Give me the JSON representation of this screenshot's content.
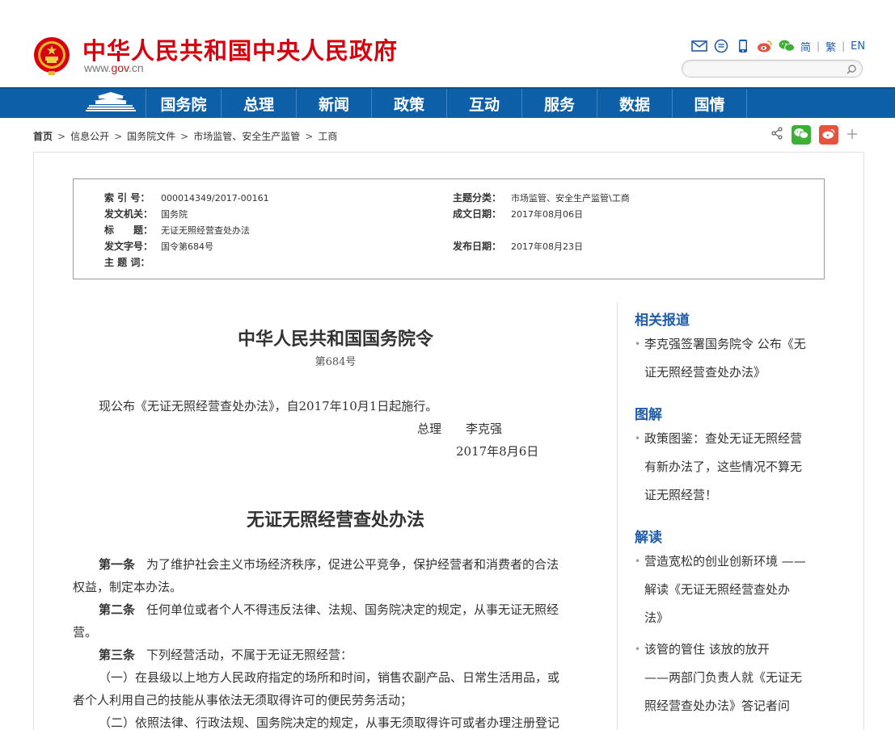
{
  "header": {
    "title": "中华人民共和国中央人民政府",
    "url_prefix": "www.",
    "url_gov": "gov",
    "url_suffix": ".cn",
    "lang_simplified": "简",
    "lang_traditional": "繁",
    "lang_english": "EN",
    "sep": "|",
    "icons": [
      "mail-icon",
      "message-icon",
      "mobile-icon",
      "weibo-icon",
      "wechat-icon"
    ]
  },
  "nav": {
    "items": [
      "国务院",
      "总理",
      "新闻",
      "政策",
      "互动",
      "服务",
      "数据",
      "国情"
    ]
  },
  "breadcrumb": {
    "items": [
      "首页",
      "信息公开",
      "国务院文件",
      "市场监管、安全生产监管",
      "工商"
    ],
    "separator": ">"
  },
  "info": {
    "index_label": "索 引 号：",
    "index_value": "000014349/2017-00161",
    "category_label": "主题分类：",
    "category_value": "市场监管、安全生产监管\\工商",
    "issuer_label": "发文机关：",
    "issuer_value": "国务院",
    "created_label": "成文日期：",
    "created_value": "2017年08月06日",
    "title_label": "标　　题：",
    "title_value": "无证无照经营查处办法",
    "docno_label": "发文字号：",
    "docno_value": "国令第684号",
    "published_label": "发布日期：",
    "published_value": "2017年08月23日",
    "keywords_label": "主 题 词："
  },
  "article": {
    "decree_title": "中华人民共和国国务院令",
    "decree_number": "第684号",
    "announcement": "现公布《无证无照经营查处办法》，自2017年10月1日起施行。",
    "signer_role": "总理",
    "signer_name": "李克强",
    "sign_date": "2017年8月6日",
    "law_title": "无证无照经营查处办法",
    "art1_label": "第一条",
    "art1_line1": "为了维护社会主义市场经济秩序，促进公平竞争，保护经营者和消费者的合法",
    "art1_line2": "权益，制定本办法。",
    "art2_label": "第二条",
    "art2_line1": "任何单位或者个人不得违反法律、法规、国务院决定的规定，从事无证无照经",
    "art2_line2": "营。",
    "art3_label": "第三条",
    "art3_line1": "下列经营活动，不属于无证无照经营：",
    "item1_line1": "（一）在县级以上地方人民政府指定的场所和时间，销售农副产品、日常生活用品，或",
    "item1_line2": "者个人利用自己的技能从事依法无须取得许可的便民劳务活动；",
    "item2_line1": "（二）依照法律、行政法规、国务院决定的规定，从事无须取得许可或者办理注册登记"
  },
  "sidebar": {
    "related_head": "相关报道",
    "related_line1": "李克强签署国务院令 公布《无",
    "related_line2": "证无照经营查处办法》",
    "graphic_head": "图解",
    "graphic_line1": "政策图鉴：查处无证无照经营",
    "graphic_line2": "有新办法了，这些情况不算无",
    "graphic_line3": "证无照经营！",
    "interpret_head": "解读",
    "interpret1_line1": "营造宽松的创业创新环境 ——",
    "interpret1_line2": "解读《无证无照经营查处办",
    "interpret1_line3": "法》",
    "interpret2_line1": "该管的管住 该放的放开",
    "interpret2_line2": "——两部门负责人就《无证无",
    "interpret2_line3": "照经营查处办法》答记者问"
  },
  "colors": {
    "brand_red": "#d7000f",
    "nav_blue": "#0d60a8",
    "link_blue": "#1f5da8",
    "wechat_green": "#3cb034",
    "weibo_red": "#e5533d"
  }
}
